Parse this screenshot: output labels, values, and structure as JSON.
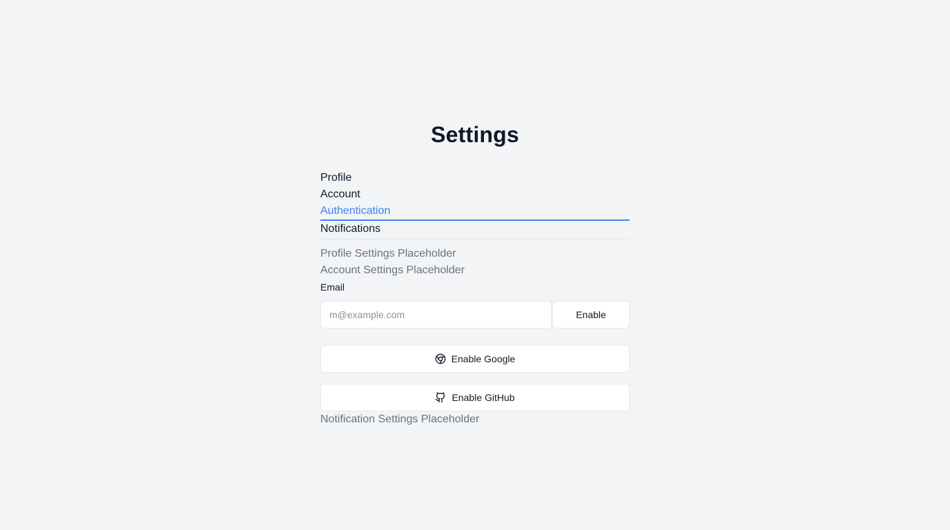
{
  "page": {
    "title": "Settings"
  },
  "tabs": [
    {
      "label": "Profile",
      "active": false
    },
    {
      "label": "Account",
      "active": false
    },
    {
      "label": "Authentication",
      "active": true
    },
    {
      "label": "Notifications",
      "active": false
    }
  ],
  "panels": {
    "profile_placeholder": "Profile Settings Placeholder",
    "account_placeholder": "Account Settings Placeholder",
    "notification_placeholder": "Notification Settings Placeholder"
  },
  "auth": {
    "email_label": "Email",
    "email_value": "",
    "email_placeholder": "m@example.com",
    "enable_label": "Enable",
    "google_label": "Enable Google",
    "google_icon": "chrome-icon",
    "github_label": "Enable GitHub",
    "github_icon": "github-icon"
  },
  "colors": {
    "background": "#f2f4f6",
    "accent": "#3b82f6",
    "muted_text": "#6b7280",
    "text": "#111827"
  }
}
